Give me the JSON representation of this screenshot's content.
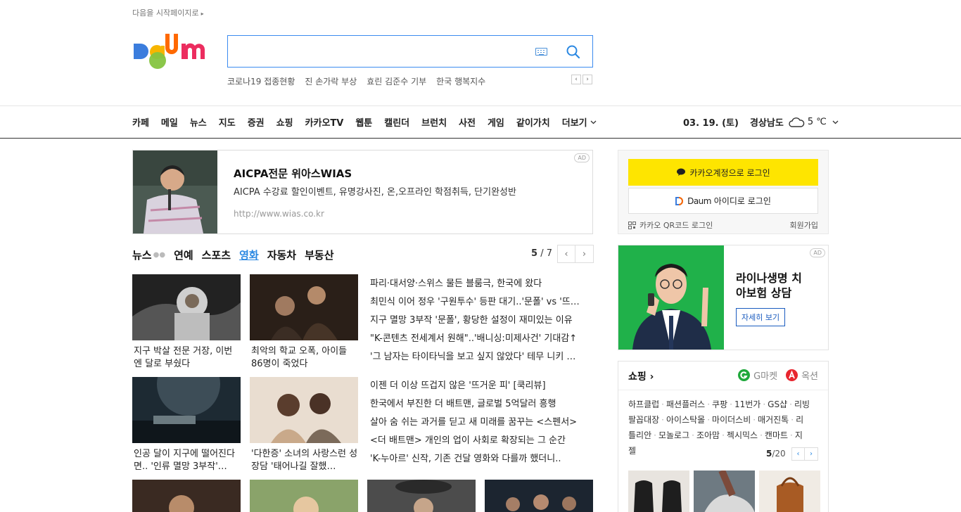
{
  "top": {
    "start_page_link": "다음을 시작페이지로"
  },
  "brand": {
    "logo_text": "Daum"
  },
  "search": {
    "placeholder": "",
    "value": ""
  },
  "trending": [
    "코로나19 접종현황",
    "진 손가락 부상",
    "효린 김준수 기부",
    "한국 행복지수"
  ],
  "nav": {
    "items": [
      "카페",
      "메일",
      "뉴스",
      "지도",
      "증권",
      "쇼핑",
      "카카오TV",
      "웹툰",
      "캘린더",
      "브런치",
      "사전",
      "게임",
      "같이가치"
    ],
    "more_label": "더보기"
  },
  "weather": {
    "date": "03. 19. (토)",
    "region": "경상남도",
    "temp": "5 ℃"
  },
  "ad_banner": {
    "title": "AICPA전문 위아스WIAS",
    "desc": "AICPA 수강료 할인이벤트, 유명강사진, 온,오프라인 학점취득, 단기완성반",
    "url": "http://www.wias.co.kr",
    "badge": "AD"
  },
  "news": {
    "tabs": [
      "뉴스",
      "연예",
      "스포츠",
      "영화",
      "자동차",
      "부동산"
    ],
    "active_tab": "영화",
    "page_current": "5",
    "page_sep": "/",
    "page_total": "7",
    "cards_row1": [
      {
        "caption": "지구 박살 전문 거장, 이번엔 달로 부쉈다"
      },
      {
        "caption": "최악의 학교 오폭, 아이들 86명이 죽었다"
      }
    ],
    "cards_row2": [
      {
        "caption": "인공 달이 지구에 떨어진다면.. '인류 멸망 3부작'…"
      },
      {
        "caption": "'다한증' 소녀의 사랑스런 성장담 '태어나길 잘했…"
      }
    ],
    "headlines_1": [
      "파리·대서양·스위스 물든 블룸극, 한국에 왔다",
      "최민식 이어 정우 '구원투수' 등판 대기..'문폴' vs '뜨…",
      "지구 멸망 3부작 '문폴', 황당한 설정이 재미있는 이유",
      "\"K-콘텐츠 전세계서 원해\"..'배니싱:미제사건' 기대감↑",
      "'그 남자는 타이타닉을 보고 싶지 않았다' 테무 니키 …"
    ],
    "headlines_2": [
      "이젠 더 이상 뜨겁지 않은 '뜨거운 피' [쿡리뷰]",
      "한국에서 부진한 더 배트맨, 글로벌 5억달러 흥행",
      "살아 숨 쉬는 과거를 딛고 새 미래를 꿈꾸는 <스펜서>",
      "<더 배트맨> 개인의 업이 사회로 확장되는 그 순간",
      "'K-누아르' 신작, 기존 건달 영화와 다를까 했더니.."
    ]
  },
  "login": {
    "kakao_label": "카카오계정으로 로그인",
    "daum_label": "아이디로 로그인",
    "daum_brand": "Daum",
    "qr_label": "카카오 QR코드 로그인",
    "signup_label": "회원가입"
  },
  "ad_right": {
    "title_line1": "라이나생명 치",
    "title_line2": "아보험 상담",
    "cta": "자세히 보기",
    "badge": "AD"
  },
  "shopping": {
    "title": "쇼핑",
    "partners": [
      "G마켓",
      "옥션"
    ],
    "links_line1": [
      "하프클럽",
      "패션플러스",
      "쿠팡",
      "11번가",
      "GS샵",
      "리빙"
    ],
    "links_line2": [
      "팔꼽대장",
      "아이스탁몰",
      "마이더스비",
      "매거진톡",
      "리"
    ],
    "links_line3": [
      "틀리안",
      "모놀로그",
      "조아맘",
      "젝시믹스",
      "캔마트",
      "지"
    ],
    "links_line4": [
      "젤"
    ],
    "page_current": "5",
    "page_total": "/20"
  },
  "colors": {
    "accent": "#2a88e2",
    "kakao": "#fee500",
    "search_border": "#3b8bf0",
    "ad_green": "#20b14a"
  }
}
